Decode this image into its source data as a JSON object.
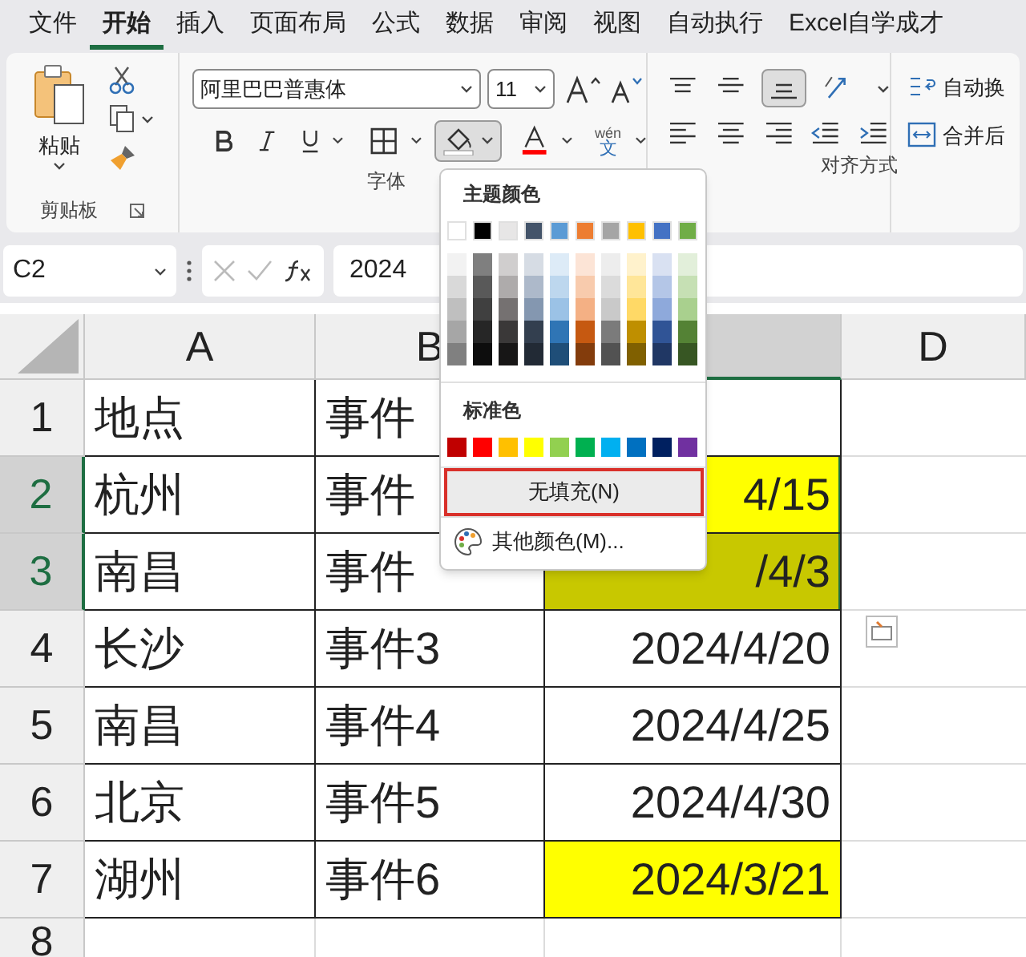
{
  "menu_tabs": [
    {
      "label": "文件",
      "selected": false
    },
    {
      "label": "开始",
      "selected": true
    },
    {
      "label": "插入",
      "selected": false
    },
    {
      "label": "页面布局",
      "selected": false
    },
    {
      "label": "公式",
      "selected": false
    },
    {
      "label": "数据",
      "selected": false
    },
    {
      "label": "审阅",
      "selected": false
    },
    {
      "label": "视图",
      "selected": false
    },
    {
      "label": "自动执行",
      "selected": false
    },
    {
      "label": "Excel自学成才",
      "selected": false
    }
  ],
  "ribbon": {
    "clipboard": {
      "paste_label": "粘贴",
      "group_label": "剪贴板"
    },
    "font": {
      "font_name": "阿里巴巴普惠体",
      "font_size": "11",
      "phonetic_top": "wén",
      "phonetic_bottom": "文",
      "group_label": "字体",
      "fill_button_pressed": true
    },
    "alignment": {
      "wrap_label": "自动换",
      "merge_label": "合并后",
      "group_label": "对齐方式"
    }
  },
  "formula_bar": {
    "name_box": "C2",
    "formula": "2024"
  },
  "columns": [
    {
      "label": "A",
      "selected": false
    },
    {
      "label": "B",
      "selected": false
    },
    {
      "selected": true
    },
    {
      "label": "D",
      "selected": false
    }
  ],
  "rows": [
    {
      "header": "1",
      "selected": false,
      "cells": [
        {
          "text": "地点",
          "selected": false
        },
        {
          "text": "事件",
          "selected": false
        },
        {
          "selected": false
        }
      ]
    },
    {
      "header": "2",
      "selected": true,
      "cells": [
        {
          "text": "杭州",
          "selected": false
        },
        {
          "text": "事件",
          "selected": false
        },
        {
          "text": "4/15",
          "selected": true,
          "color": "#ffff00"
        }
      ]
    },
    {
      "header": "3",
      "selected": true,
      "cells": [
        {
          "text": "南昌",
          "selected": false
        },
        {
          "text": "事件",
          "selected": false
        },
        {
          "text": "/4/3",
          "selected": true,
          "color": "#c8c800"
        }
      ]
    },
    {
      "header": "4",
      "selected": false,
      "cells": [
        {
          "text": "长沙",
          "selected": false
        },
        {
          "text": "事件3",
          "selected": false
        },
        {
          "text": "2024/4/20",
          "selected": false
        }
      ]
    },
    {
      "header": "5",
      "selected": false,
      "cells": [
        {
          "text": "南昌",
          "selected": false
        },
        {
          "text": "事件4",
          "selected": false
        },
        {
          "text": "2024/4/25",
          "selected": false
        }
      ]
    },
    {
      "header": "6",
      "selected": false,
      "cells": [
        {
          "text": "北京",
          "selected": false
        },
        {
          "text": "事件5",
          "selected": false
        },
        {
          "text": "2024/4/30",
          "selected": false
        }
      ]
    },
    {
      "header": "7",
      "selected": false,
      "cells": [
        {
          "text": "湖州",
          "selected": false
        },
        {
          "text": "事件6",
          "selected": false
        },
        {
          "text": "2024/3/21",
          "selected": false,
          "color": "#ffff00"
        }
      ]
    },
    {
      "header": "8",
      "selected": false,
      "cells": [
        {
          "selected": false
        },
        {
          "selected": false
        },
        {
          "selected": false
        }
      ]
    }
  ],
  "fill_menu": {
    "theme_title": "主题颜色",
    "theme_colors": [
      {
        "color": "#ffffff",
        "shades": [
          {
            "color": "#f2f2f2"
          },
          {
            "color": "#d9d9d9"
          },
          {
            "color": "#bfbfbf"
          },
          {
            "color": "#a6a6a6"
          },
          {
            "color": "#808080"
          }
        ]
      },
      {
        "color": "#000000",
        "shades": [
          {
            "color": "#7f7f7f"
          },
          {
            "color": "#595959"
          },
          {
            "color": "#404040"
          },
          {
            "color": "#262626"
          },
          {
            "color": "#0d0d0d"
          }
        ]
      },
      {
        "color": "#e7e6e6",
        "shades": [
          {
            "color": "#d0cece"
          },
          {
            "color": "#aeabab"
          },
          {
            "color": "#757171"
          },
          {
            "color": "#3a3838"
          },
          {
            "color": "#171616"
          }
        ]
      },
      {
        "color": "#44546a",
        "shades": [
          {
            "color": "#d6dce4"
          },
          {
            "color": "#adb9ca"
          },
          {
            "color": "#8497b0"
          },
          {
            "color": "#333f4f"
          },
          {
            "color": "#222a35"
          }
        ]
      },
      {
        "color": "#5b9bd5",
        "shades": [
          {
            "color": "#ddebf7"
          },
          {
            "color": "#bdd7ee"
          },
          {
            "color": "#9bc2e6"
          },
          {
            "color": "#2f75b5"
          },
          {
            "color": "#1f4e78"
          }
        ]
      },
      {
        "color": "#ed7d31",
        "shades": [
          {
            "color": "#fce4d6"
          },
          {
            "color": "#f8cbad"
          },
          {
            "color": "#f4b084"
          },
          {
            "color": "#c65911"
          },
          {
            "color": "#833c0c"
          }
        ]
      },
      {
        "color": "#a5a5a5",
        "shades": [
          {
            "color": "#ededed"
          },
          {
            "color": "#dbdbdb"
          },
          {
            "color": "#c9c9c9"
          },
          {
            "color": "#7b7b7b"
          },
          {
            "color": "#525252"
          }
        ]
      },
      {
        "color": "#ffc000",
        "shades": [
          {
            "color": "#fff2cc"
          },
          {
            "color": "#ffe699"
          },
          {
            "color": "#ffd966"
          },
          {
            "color": "#bf8f00"
          },
          {
            "color": "#806000"
          }
        ]
      },
      {
        "color": "#4472c4",
        "shades": [
          {
            "color": "#d9e1f2"
          },
          {
            "color": "#b4c6e7"
          },
          {
            "color": "#8ea9db"
          },
          {
            "color": "#305496"
          },
          {
            "color": "#203764"
          }
        ]
      },
      {
        "color": "#70ad47",
        "shades": [
          {
            "color": "#e2efda"
          },
          {
            "color": "#c6e0b4"
          },
          {
            "color": "#a9d08e"
          },
          {
            "color": "#548235"
          },
          {
            "color": "#375623"
          }
        ]
      }
    ],
    "standard_title": "标准色",
    "standard_colors": [
      {
        "color": "#c00000"
      },
      {
        "color": "#ff0000"
      },
      {
        "color": "#ffc000"
      },
      {
        "color": "#ffff00"
      },
      {
        "color": "#92d050"
      },
      {
        "color": "#00b050"
      },
      {
        "color": "#00b0f0"
      },
      {
        "color": "#0070c0"
      },
      {
        "color": "#002060"
      },
      {
        "color": "#7030a0"
      }
    ],
    "items": [
      {
        "label": "无填充(N)",
        "kind": "plain",
        "highlighted": true
      },
      {
        "label": "其他颜色(M)...",
        "kind": "palette",
        "highlighted": false
      }
    ]
  }
}
